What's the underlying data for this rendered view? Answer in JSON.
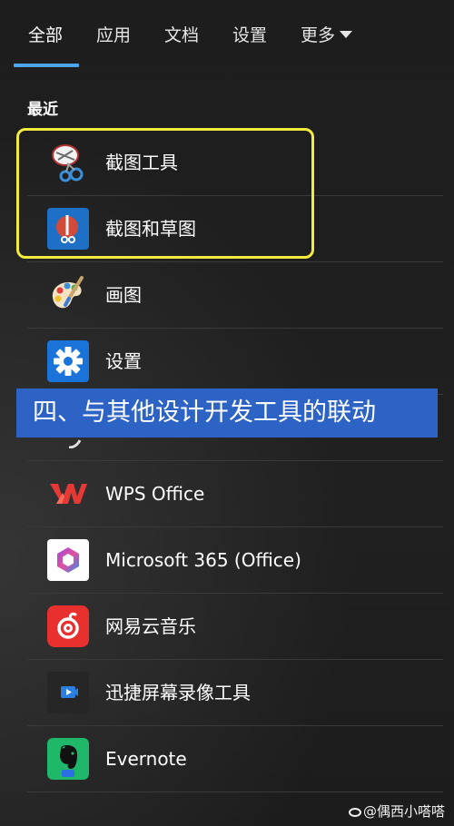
{
  "tabs": [
    {
      "label": "全部",
      "active": true
    },
    {
      "label": "应用",
      "active": false
    },
    {
      "label": "文档",
      "active": false
    },
    {
      "label": "设置",
      "active": false
    },
    {
      "label": "更多",
      "active": false
    }
  ],
  "section_title": "最近",
  "items": [
    {
      "label": "截图工具",
      "icon": "snipping-tool-icon"
    },
    {
      "label": "截图和草图",
      "icon": "snip-sketch-icon"
    },
    {
      "label": "画图",
      "icon": "paint-palette-icon"
    },
    {
      "label": "设置",
      "icon": "gear-icon"
    },
    {
      "label": "",
      "icon": "partially-hidden-icon"
    },
    {
      "label": "WPS Office",
      "icon": "wps-office-icon"
    },
    {
      "label": "Microsoft 365 (Office)",
      "icon": "microsoft-365-icon"
    },
    {
      "label": "网易云音乐",
      "icon": "netease-music-icon"
    },
    {
      "label": "迅捷屏幕录像工具",
      "icon": "screen-recorder-icon"
    },
    {
      "label": "Evernote",
      "icon": "evernote-icon"
    }
  ],
  "banner_text": "四、与其他设计开发工具的联动",
  "watermark": "@偶西小嗒嗒",
  "colors": {
    "accent": "#4aa6f0",
    "highlight": "#f2ea3c",
    "banner": "#2d63c4",
    "background": "#1f1f1f"
  }
}
